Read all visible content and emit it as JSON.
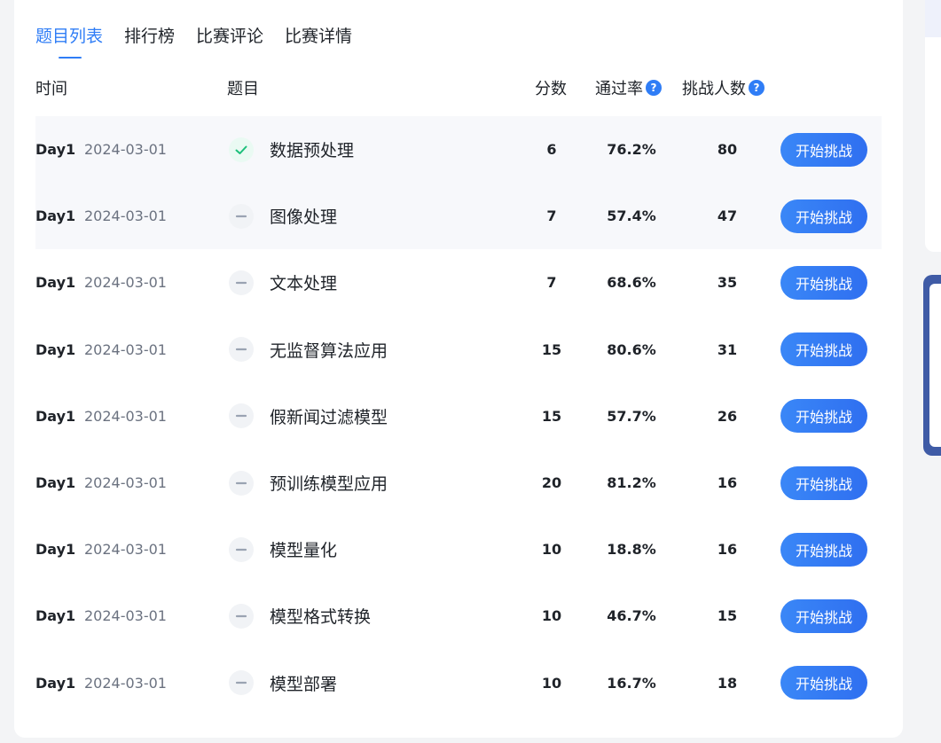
{
  "tabs": [
    {
      "label": "题目列表",
      "active": true
    },
    {
      "label": "排行榜",
      "active": false
    },
    {
      "label": "比赛评论",
      "active": false
    },
    {
      "label": "比赛详情",
      "active": false
    }
  ],
  "table": {
    "headers": {
      "time": "时间",
      "title": "题目",
      "score": "分数",
      "pass_rate": "通过率",
      "challengers": "挑战人数"
    },
    "help_glyph": "?",
    "rows": [
      {
        "day": "Day1",
        "date": "2024-03-01",
        "status": "completed",
        "title": "数据预处理",
        "score": "6",
        "pass_rate": "76.2%",
        "challengers": "80",
        "action": "开始挑战"
      },
      {
        "day": "Day1",
        "date": "2024-03-01",
        "status": "not-started",
        "title": "图像处理",
        "score": "7",
        "pass_rate": "57.4%",
        "challengers": "47",
        "action": "开始挑战"
      },
      {
        "day": "Day1",
        "date": "2024-03-01",
        "status": "not-started",
        "title": "文本处理",
        "score": "7",
        "pass_rate": "68.6%",
        "challengers": "35",
        "action": "开始挑战"
      },
      {
        "day": "Day1",
        "date": "2024-03-01",
        "status": "not-started",
        "title": "无监督算法应用",
        "score": "15",
        "pass_rate": "80.6%",
        "challengers": "31",
        "action": "开始挑战"
      },
      {
        "day": "Day1",
        "date": "2024-03-01",
        "status": "not-started",
        "title": "假新闻过滤模型",
        "score": "15",
        "pass_rate": "57.7%",
        "challengers": "26",
        "action": "开始挑战"
      },
      {
        "day": "Day1",
        "date": "2024-03-01",
        "status": "not-started",
        "title": "预训练模型应用",
        "score": "20",
        "pass_rate": "81.2%",
        "challengers": "16",
        "action": "开始挑战"
      },
      {
        "day": "Day1",
        "date": "2024-03-01",
        "status": "not-started",
        "title": "模型量化",
        "score": "10",
        "pass_rate": "18.8%",
        "challengers": "16",
        "action": "开始挑战"
      },
      {
        "day": "Day1",
        "date": "2024-03-01",
        "status": "not-started",
        "title": "模型格式转换",
        "score": "10",
        "pass_rate": "46.7%",
        "challengers": "15",
        "action": "开始挑战"
      },
      {
        "day": "Day1",
        "date": "2024-03-01",
        "status": "not-started",
        "title": "模型部署",
        "score": "10",
        "pass_rate": "16.7%",
        "challengers": "18",
        "action": "开始挑战"
      }
    ]
  },
  "colors": {
    "accent": "#2f7df6",
    "success": "#1bbf7a",
    "muted_icon": "#9aa3b2",
    "side_panel": "#3f5ba6"
  }
}
